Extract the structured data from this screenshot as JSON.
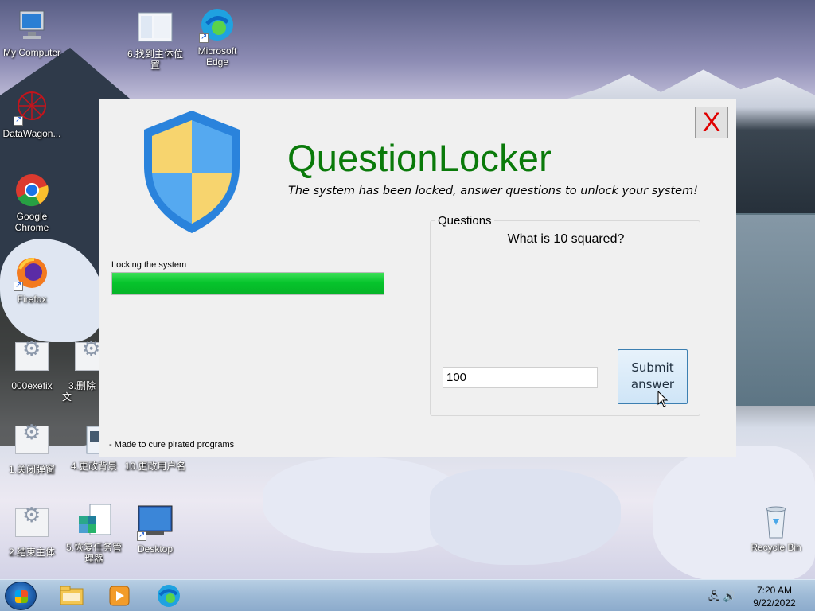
{
  "desktop": {
    "icons": [
      {
        "label": "My Computer"
      },
      {
        "label": "6.找到主体位置"
      },
      {
        "label": "Microsoft Edge"
      },
      {
        "label": "DataWagon..."
      },
      {
        "label": "Google Chrome"
      },
      {
        "label": "Firefox"
      },
      {
        "label": "000exefix"
      },
      {
        "label": "3.删除文"
      },
      {
        "label": "1.关闭弹窗"
      },
      {
        "label": "4.更改背景"
      },
      {
        "label": "10.更改用户名"
      },
      {
        "label": "2.结束主体"
      },
      {
        "label": "5.恢复任务管理器"
      },
      {
        "label": "Desktop"
      },
      {
        "label": "Recycle Bin"
      }
    ]
  },
  "dialog": {
    "close_label": "X",
    "title": "QuestionLocker",
    "subtitle": "The system has been locked, answer questions to unlock your system!",
    "progress_label": "Locking the system",
    "progress_value": 1.0,
    "footer": "- Made to cure pirated programs",
    "questions": {
      "group_title": "Questions",
      "question": "What is 10 squared?",
      "answer_value": "100",
      "submit_label": "Submit answer"
    },
    "colors": {
      "title": "#0a7a0a",
      "close": "#e00000",
      "progress": "#06c42c"
    }
  },
  "taskbar": {
    "time": "7:20 AM",
    "date": "9/22/2022",
    "pinned": [
      "file-explorer-icon",
      "media-player-icon",
      "edge-icon"
    ]
  }
}
